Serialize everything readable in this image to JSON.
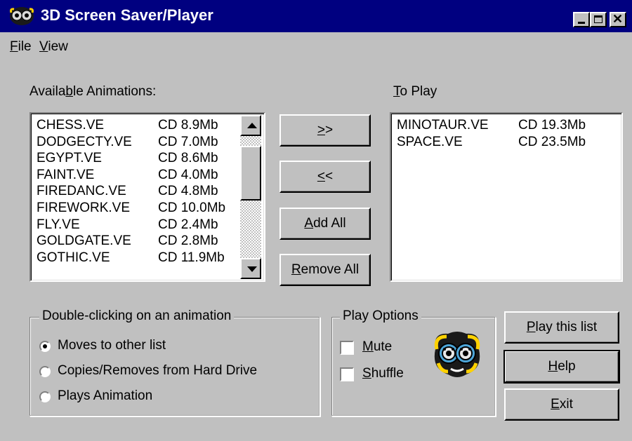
{
  "window": {
    "title": "3D Screen Saver/Player"
  },
  "menu": [
    {
      "label_pre": "",
      "key": "F",
      "label_post": "ile"
    },
    {
      "label_pre": "",
      "key": "V",
      "label_post": "iew"
    }
  ],
  "available": {
    "label_pre": "Availa",
    "key": "b",
    "label_post": "le Animations:",
    "items": [
      {
        "name": "CHESS.VE",
        "info": "CD 8.9Mb"
      },
      {
        "name": "DODGECTY.VE",
        "info": "CD 7.0Mb"
      },
      {
        "name": "EGYPT.VE",
        "info": "CD 8.6Mb"
      },
      {
        "name": "FAINT.VE",
        "info": "CD 4.0Mb"
      },
      {
        "name": "FIREDANC.VE",
        "info": "CD 4.8Mb"
      },
      {
        "name": "FIREWORK.VE",
        "info": "CD 10.0Mb"
      },
      {
        "name": "FLY.VE",
        "info": "CD 2.4Mb"
      },
      {
        "name": "GOLDGATE.VE",
        "info": "CD 2.8Mb"
      },
      {
        "name": "GOTHIC.VE",
        "info": "CD 11.9Mb"
      }
    ]
  },
  "to_play": {
    "label_pre": "",
    "key": "T",
    "label_post": "o Play",
    "items": [
      {
        "name": "MINOTAUR.VE",
        "info": "CD 19.3Mb"
      },
      {
        "name": "SPACE.VE",
        "info": "CD 23.5Mb"
      }
    ]
  },
  "buttons": {
    "move_right": {
      "key": ">",
      "rest": ">"
    },
    "move_left": {
      "key": "<",
      "rest": "<"
    },
    "add_all": {
      "pre": "",
      "key": "A",
      "rest": "dd All"
    },
    "remove_all": {
      "pre": "",
      "key": "R",
      "rest": "emove All"
    },
    "play_list": {
      "pre": "",
      "key": "P",
      "rest": "lay this list"
    },
    "help": {
      "pre": "",
      "key": "H",
      "rest": "elp"
    },
    "exit": {
      "pre": "",
      "key": "E",
      "rest": "xit"
    }
  },
  "double_click": {
    "legend": "Double-clicking on an animation",
    "options": [
      {
        "label": "Moves to other list",
        "selected": true
      },
      {
        "label": "Copies/Removes from Hard Drive",
        "selected": false
      },
      {
        "label": "Plays Animation",
        "selected": false
      }
    ]
  },
  "play_options": {
    "legend": "Play Options",
    "mute": {
      "pre": "",
      "key": "M",
      "rest": "ute",
      "checked": false
    },
    "shuffle": {
      "pre": "",
      "key": "S",
      "rest": "huffle",
      "checked": false
    }
  },
  "colors": {
    "titlebar": "#000080",
    "face": "#c0c0c0"
  },
  "icons": {
    "app": "film-reel-face-icon",
    "minimize": "minimize-icon",
    "maximize": "maximize-icon",
    "close": "close-icon"
  }
}
